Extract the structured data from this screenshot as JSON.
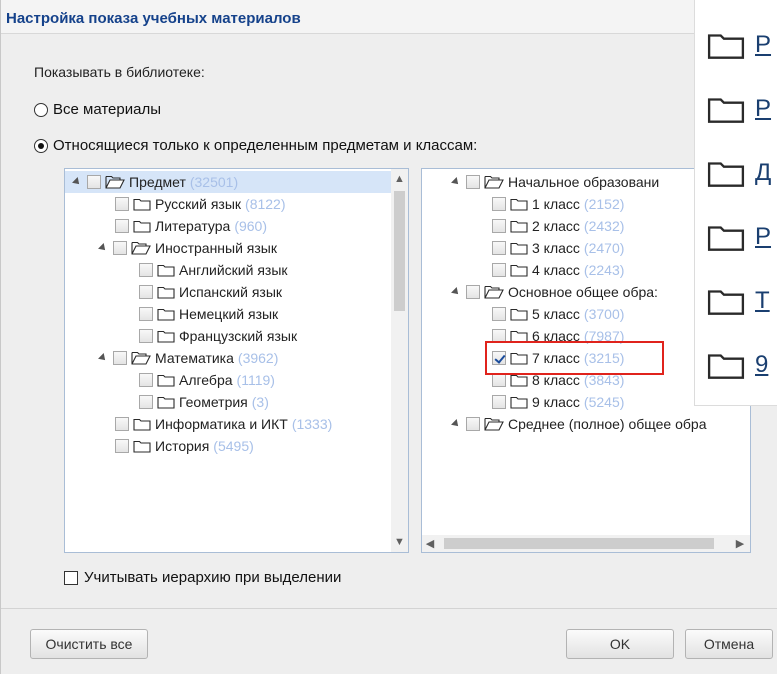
{
  "dialog": {
    "title": "Настройка показа учебных материалов",
    "show_in_library_label": "Показывать в библиотеке:",
    "radio_all": "Все материалы",
    "radio_specific": "Относящиеся только к определенным предметам и классам:",
    "hierarchy_checkbox": "Учитывать иерархию при выделении",
    "clear_all_button": "Очистить все",
    "ok_button": "OK",
    "cancel_button": "Отмена"
  },
  "subjects_tree": [
    {
      "label": "Предмет",
      "count": "(32501)"
    },
    {
      "label": "Русский язык",
      "count": "(8122)"
    },
    {
      "label": "Литература",
      "count": "(960)"
    },
    {
      "label": "Иностранный язык",
      "count": ""
    },
    {
      "label": "Английский язык",
      "count": ""
    },
    {
      "label": "Испанский язык",
      "count": ""
    },
    {
      "label": "Немецкий язык",
      "count": ""
    },
    {
      "label": "Французский язык",
      "count": ""
    },
    {
      "label": "Математика",
      "count": "(3962)"
    },
    {
      "label": "Алгебра",
      "count": "(1119)"
    },
    {
      "label": "Геометрия",
      "count": "(3)"
    },
    {
      "label": "Информатика и ИКТ",
      "count": "(1333)"
    },
    {
      "label": "История",
      "count": "(5495)"
    }
  ],
  "grades_tree": [
    {
      "label": "Начальное образовани",
      "count": ""
    },
    {
      "label": "1 класс",
      "count": "(2152)"
    },
    {
      "label": "2 класс",
      "count": "(2432)"
    },
    {
      "label": "3 класс",
      "count": "(2470)"
    },
    {
      "label": "4 класс",
      "count": "(2243)"
    },
    {
      "label": "Основное общее обра:",
      "count": ""
    },
    {
      "label": "5 класс",
      "count": "(3700)"
    },
    {
      "label": "6 класс",
      "count": "(7987)"
    },
    {
      "label": "7 класс",
      "count": "(3215)"
    },
    {
      "label": "8 класс",
      "count": "(3843)"
    },
    {
      "label": "9 класс",
      "count": "(5245)"
    },
    {
      "label": "Среднее (полное) общее обра",
      "count": ""
    }
  ],
  "overlay_items": [
    "Р",
    "Р",
    "Д",
    "Р",
    "Т",
    "9"
  ],
  "colors": {
    "title": "#15428b",
    "count": "#a8c0e8",
    "selection": "#d6e5f8",
    "highlight_box": "#e0231c"
  }
}
